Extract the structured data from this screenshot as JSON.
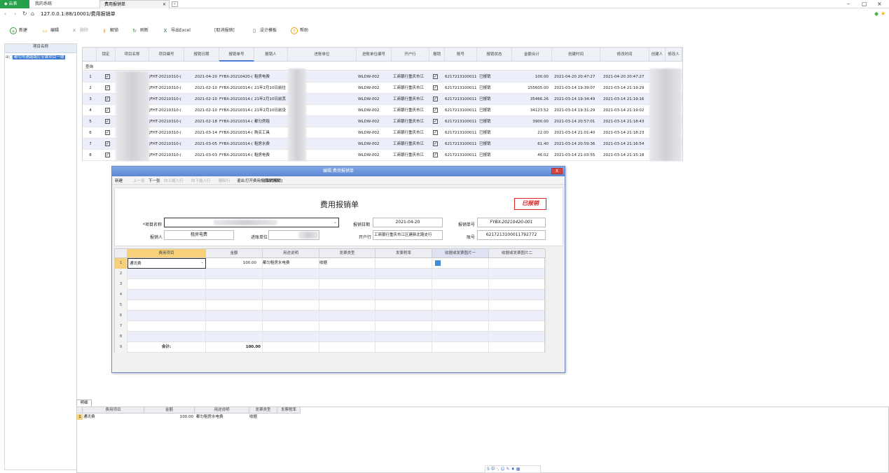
{
  "browser": {
    "tabs": [
      "云表",
      "我的系统",
      "费用报销单"
    ],
    "tab_close": "×",
    "url": "127.0.0.1:88/10001/费用报销单",
    "window_controls": [
      "–",
      "▢",
      "×"
    ]
  },
  "toolbar": {
    "new": "新建",
    "edit": "编辑",
    "delete": "删除",
    "unlock": "解锁",
    "refresh": "刷新",
    "export": "导出Excel",
    "cancel_reimb": "[取消报销]",
    "design": "设计模板",
    "help": "帮助"
  },
  "tree": {
    "header_line1": "项目名称",
    "header_line2": "",
    "item": "都匀市通路路灯安装项目一期"
  },
  "grid": {
    "headers": [
      "锁定",
      "项目名称",
      "项目编号",
      "报销日期",
      "报销单号",
      "报销人",
      "进账单位",
      "进账单位编号",
      "开户行",
      "报销",
      "账号",
      "报销状态",
      "金额合计",
      "创建时间",
      "修改时间",
      "创建人",
      "修改人"
    ],
    "filter_label": "查询",
    "rows": [
      {
        "n": "1",
        "proj_no": "JFHT-20210310-(",
        "date": "2021-04-20",
        "no": "FYBX-20210420-(",
        "person": "租房电费",
        "unit_no": "WLDW-002",
        "bank": "工商银行重庆市江",
        "acct": "6217213100011",
        "status": "已报销",
        "amount": "100.00",
        "created": "2021-04-20 20:47:27",
        "modified": "2021-04-20 20:47:27"
      },
      {
        "n": "2",
        "proj_no": "JFHT-20210310-(",
        "date": "2021-02-10",
        "no": "FYBX-20210314-(",
        "person": "21年2月10日前往",
        "unit_no": "WLDW-002",
        "bank": "工商银行重庆市江",
        "acct": "6217213100011",
        "status": "已报销",
        "amount": "155605.00",
        "created": "2021-03-14 19:39:07",
        "modified": "2021-03-14 21:19:29"
      },
      {
        "n": "3",
        "proj_no": "JFHT-20210310-(",
        "date": "2021-02-10",
        "no": "FYBX-20210314-(",
        "person": "21年2月10日前其",
        "unit_no": "WLDW-002",
        "bank": "工商银行重庆市江",
        "acct": "6217213100011",
        "status": "已报销",
        "amount": "35466.26",
        "created": "2021-03-14 19:34:49",
        "modified": "2021-03-14 21:19:16"
      },
      {
        "n": "4",
        "proj_no": "JFHT-20210310-(",
        "date": "2021-02-10",
        "no": "FYBX-20210314-(",
        "person": "21年2月10日前设",
        "unit_no": "WLDW-002",
        "bank": "工商银行重庆市江",
        "acct": "6217213100011",
        "status": "已报销",
        "amount": "34123.52",
        "created": "2021-03-14 19:31:29",
        "modified": "2021-03-14 21:19:02"
      },
      {
        "n": "5",
        "proj_no": "JFHT-20210310-(",
        "date": "2021-02-18",
        "no": "FYBX-20210314-(",
        "person": "都匀房租",
        "unit_no": "WLDW-002",
        "bank": "工商银行重庆市江",
        "acct": "6217213100011",
        "status": "已报销",
        "amount": "3900.00",
        "created": "2021-03-14 20:57:01",
        "modified": "2021-03-14 21:18:43"
      },
      {
        "n": "6",
        "proj_no": "JFHT-20210310-(",
        "date": "2021-03-14",
        "no": "FYBX-20210314-(",
        "person": "购买工具",
        "unit_no": "WLDW-002",
        "bank": "工商银行重庆市江",
        "acct": "6217213100011",
        "status": "已报销",
        "amount": "22.00",
        "created": "2021-03-14 21:01:40",
        "modified": "2021-03-14 21:18:23"
      },
      {
        "n": "7",
        "proj_no": "JFHT-20210310-(",
        "date": "2021-03-05",
        "no": "FYBX-20210314-(",
        "person": "租房水费",
        "unit_no": "WLDW-002",
        "bank": "工商银行重庆市江",
        "acct": "6217213100011",
        "status": "已报销",
        "amount": "61.40",
        "created": "2021-03-14 20:59:36",
        "modified": "2021-03-14 21:16:54"
      },
      {
        "n": "8",
        "proj_no": "JFHT-20210310-(",
        "date": "2021-03-03",
        "no": "FYBX-20210314-(",
        "person": "租房电费",
        "unit_no": "WLDW-002",
        "bank": "工商银行重庆市江",
        "acct": "6217213100011",
        "status": "已报销",
        "amount": "46.02",
        "created": "2021-03-14 21:03:55",
        "modified": "2021-03-14 21:15:18"
      }
    ]
  },
  "dialog": {
    "title": "编辑:费用报销单",
    "close": "X",
    "toolbar": [
      "新建",
      "上一张",
      "下一张",
      "向上插入行",
      "向下插入行",
      "删除行",
      "退出",
      "打开费用报销单列表",
      "[取消报销]"
    ],
    "form_title": "费用报销单",
    "stamp": "已报销",
    "labels": {
      "project": "*项目名称",
      "date": "报销日期",
      "no": "报销单号",
      "person": "报销人",
      "unit": "进账单位",
      "bank": "开户行",
      "acct": "账号"
    },
    "values": {
      "date": "2021-04-20",
      "no": "FYBX-20210420-001",
      "person": "租房电费",
      "bank": "工商银行重庆市江区建新北路支行",
      "acct": "6217213100011792772"
    },
    "detail_headers": [
      "费用项目",
      "金额",
      "用途说明",
      "发票类型",
      "发票税率",
      "收据或发票图片一",
      "收据或发票图片二"
    ],
    "detail_row1": {
      "item": "通讯费",
      "amount": "100.00",
      "desc": "都匀租房水电费",
      "type": "收据"
    },
    "row_numbers": [
      "1",
      "2",
      "3",
      "4",
      "5",
      "6",
      "7",
      "8",
      "9"
    ],
    "total_label": "合计:",
    "total_value": "100.00"
  },
  "bottom": {
    "tab": "明细",
    "headers": [
      "费用项目",
      "金额",
      "用途说明",
      "发票类型",
      "发票税率"
    ],
    "row": {
      "n": "1",
      "item": "通讯费",
      "amount": "100.00",
      "desc": "都匀租房水电费",
      "type": "收据"
    }
  },
  "ime": "S 中 ·, ☺ ✎ ♦ ▦"
}
